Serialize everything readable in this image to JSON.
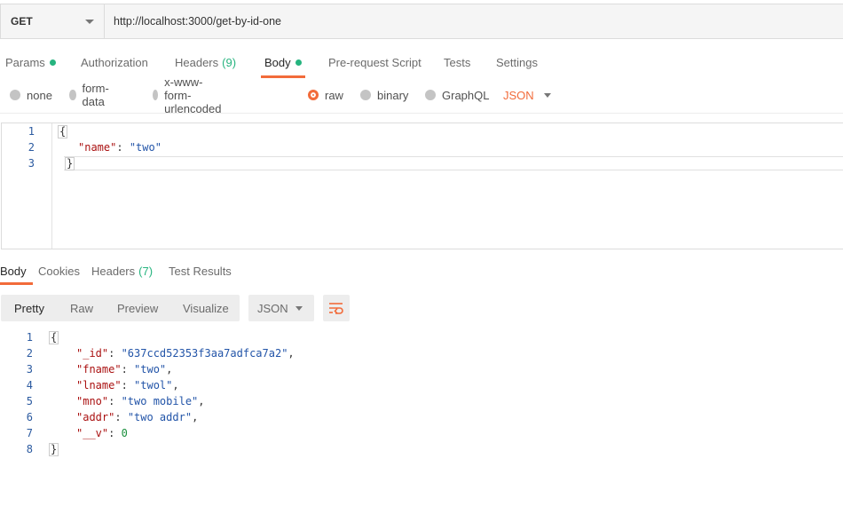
{
  "request": {
    "method": "GET",
    "url": "http://localhost:3000/get-by-id-one"
  },
  "request_tabs": [
    {
      "label": "Params",
      "dot": true,
      "count": ""
    },
    {
      "label": "Authorization",
      "dot": false,
      "count": ""
    },
    {
      "label": "Headers",
      "dot": false,
      "count": "(9)"
    },
    {
      "label": "Body",
      "dot": true,
      "count": "",
      "active": true
    },
    {
      "label": "Pre-request Script",
      "dot": false,
      "count": ""
    },
    {
      "label": "Tests",
      "dot": false,
      "count": ""
    },
    {
      "label": "Settings",
      "dot": false,
      "count": ""
    }
  ],
  "body_types": [
    {
      "label": "none",
      "selected": false
    },
    {
      "label": "form-data",
      "selected": false
    },
    {
      "label": "x-www-form-urlencoded",
      "selected": false
    },
    {
      "label": "raw",
      "selected": true
    },
    {
      "label": "binary",
      "selected": false
    },
    {
      "label": "GraphQL",
      "selected": false
    }
  ],
  "body_format": "JSON",
  "request_body": {
    "line_numbers": [
      "1",
      "2",
      "3"
    ],
    "open_brace": "{",
    "key": "\"name\"",
    "colon": ": ",
    "value": "\"two\"",
    "close_brace": "}"
  },
  "response_tabs": [
    {
      "label": "Body",
      "count": "",
      "active": true
    },
    {
      "label": "Cookies",
      "count": ""
    },
    {
      "label": "Headers",
      "count": "(7)"
    },
    {
      "label": "Test Results",
      "count": ""
    }
  ],
  "view_modes": [
    "Pretty",
    "Raw",
    "Preview",
    "Visualize"
  ],
  "active_view": "Pretty",
  "response_format": "JSON",
  "wrap_icon": "wrap-lines-icon",
  "response_body": {
    "line_numbers": [
      "1",
      "2",
      "3",
      "4",
      "5",
      "6",
      "7",
      "8"
    ],
    "open_brace": "{",
    "close_brace": "}",
    "fields": [
      {
        "key": "\"_id\"",
        "value": "\"637ccd52353f3aa7adfca7a2\"",
        "type": "string",
        "comma": ","
      },
      {
        "key": "\"fname\"",
        "value": "\"two\"",
        "type": "string",
        "comma": ","
      },
      {
        "key": "\"lname\"",
        "value": "\"twol\"",
        "type": "string",
        "comma": ","
      },
      {
        "key": "\"mno\"",
        "value": "\"two mobile\"",
        "type": "string",
        "comma": ","
      },
      {
        "key": "\"addr\"",
        "value": "\"two addr\"",
        "type": "string",
        "comma": ","
      },
      {
        "key": "\"__v\"",
        "value": "0",
        "type": "number",
        "comma": ""
      }
    ]
  },
  "colors": {
    "accent": "#f26b3a",
    "status_dot": "#26b47f",
    "json_key": "#aa1111",
    "json_string": "#2254a8",
    "json_number": "#1a8f3c"
  }
}
